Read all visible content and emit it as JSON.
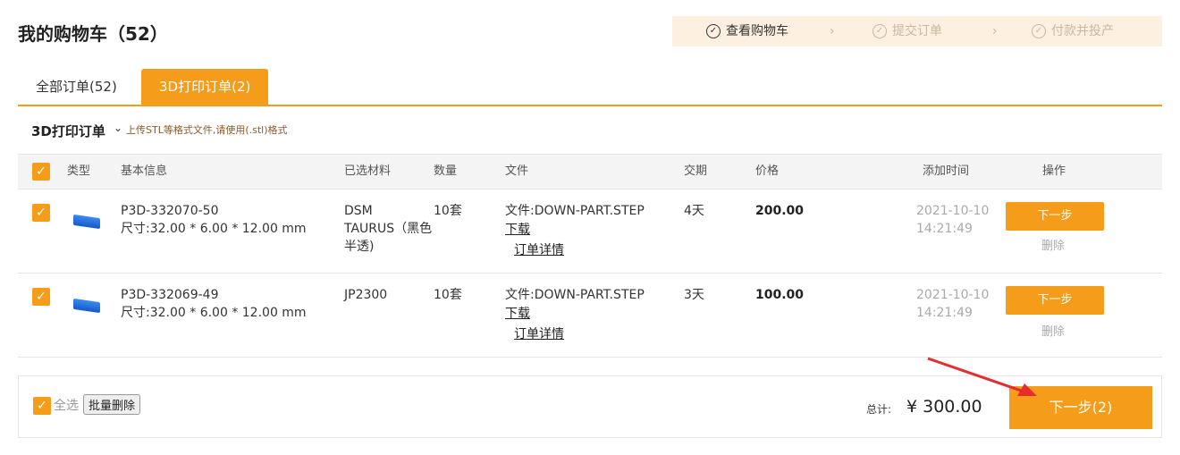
{
  "page": {
    "title": "我的购物车（52）"
  },
  "steps": [
    {
      "label": "查看购物车",
      "state": "active"
    },
    {
      "label": "提交订单",
      "state": "inactive"
    },
    {
      "label": "付款并投产",
      "state": "inactive"
    }
  ],
  "tabs": [
    {
      "label": "全部订单(52)",
      "selected": false
    },
    {
      "label": "3D打印订单(2)",
      "selected": true
    }
  ],
  "section": {
    "title": "3D打印订单",
    "hint": "上传STL等格式文件,请使用(.stl)格式"
  },
  "table": {
    "headers": [
      "类型",
      "基本信息",
      "已选材料",
      "数量",
      "文件",
      "交期",
      "价格",
      "添加时间",
      "操作"
    ],
    "rows": [
      {
        "checked": true,
        "id": "P3D-332070-50",
        "size": "尺寸:32.00 * 6.00 * 12.00 mm",
        "material_lines": [
          "DSM",
          "TAURUS（黑色",
          "半透)"
        ],
        "qty": "10套",
        "file": "文件:DOWN-PART.STEP",
        "download": "下载",
        "detail": "订单详情",
        "lead": "4天",
        "price": "200.00",
        "date": "2021-10-10",
        "time": "14:21:49",
        "next": "下一步",
        "delete": "删除"
      },
      {
        "checked": true,
        "id": "P3D-332069-49",
        "size": "尺寸:32.00 * 6.00 * 12.00 mm",
        "material_lines": [
          "JP2300"
        ],
        "qty": "10套",
        "file": "文件:DOWN-PART.STEP",
        "download": "下载",
        "detail": "订单详情",
        "lead": "3天",
        "price": "100.00",
        "date": "2021-10-10",
        "time": "14:21:49",
        "next": "下一步",
        "delete": "删除"
      }
    ]
  },
  "footer": {
    "select_all": "全选",
    "batch_delete": "批量删除",
    "total_label": "总计:",
    "total_value": "¥ 300.00",
    "next": "下一步(2)"
  },
  "colors": {
    "accent": "#f59c1a",
    "steps_bg": "#fdf0e1",
    "annotation_arrow": "#e52d2d"
  },
  "icons": [
    "check-circle-icon",
    "chevron-right-icon",
    "chevron-down-icon",
    "checkbox-checked-icon",
    "part-thumbnail-icon",
    "red-pointer-arrow"
  ]
}
